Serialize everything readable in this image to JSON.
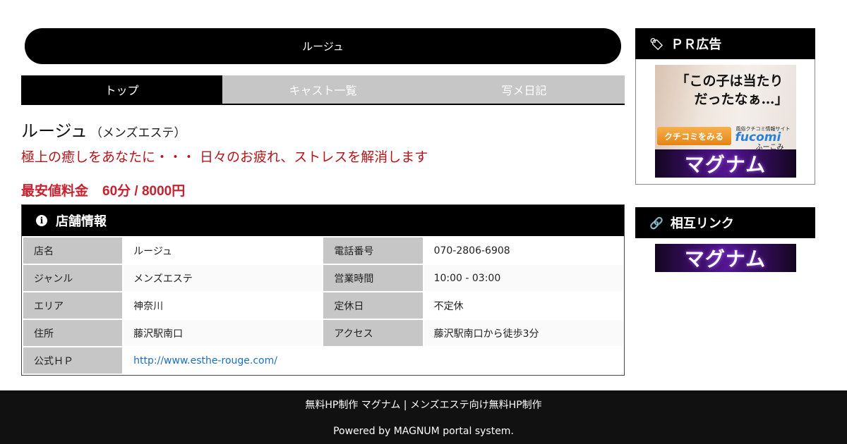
{
  "banner": {
    "title": "ルージュ"
  },
  "tabs": [
    {
      "label": "トップ",
      "active": true
    },
    {
      "label": "キャスト一覧",
      "active": false
    },
    {
      "label": "写メ日記",
      "active": false
    }
  ],
  "shop": {
    "name": "ルージュ",
    "genre": "（メンズエステ）",
    "catch": "極上の癒しをあなたに・・・ 日々のお疲れ、ストレスを解消します",
    "price_label": "最安値料金",
    "price_value": "60分 / 8000円"
  },
  "info": {
    "header": "店舗情報",
    "icon": "info-icon",
    "rows": [
      [
        {
          "label": "店名",
          "value": "ルージュ"
        },
        {
          "label": "電話番号",
          "value": "070-2806-6908"
        }
      ],
      [
        {
          "label": "ジャンル",
          "value": "メンズエステ"
        },
        {
          "label": "営業時間",
          "value": "10:00 - 03:00"
        }
      ],
      [
        {
          "label": "エリア",
          "value": "神奈川"
        },
        {
          "label": "定休日",
          "value": "不定休"
        }
      ],
      [
        {
          "label": "住所",
          "value": "藤沢駅南口"
        },
        {
          "label": "アクセス",
          "value": "藤沢駅南口から徒歩3分"
        }
      ]
    ],
    "hp_label": "公式ＨＰ",
    "hp_url": "http://www.esthe-rouge.com/"
  },
  "sidebar": {
    "pr_title": "ＰＲ広告",
    "pr_icon": "tags-icon",
    "ad_fucomi": {
      "line1": "「この子は当たり",
      "line2": "だったなぁ…」",
      "button": "クチコミをみる",
      "logo_sub": "風俗クチコミ情報サイト",
      "logo": "fucomi",
      "logo_kana": "ふーこみ"
    },
    "ad_magnum": "マグナム",
    "link_title": "相互リンク",
    "link_icon": "link-icon",
    "link_magnum": "マグナム"
  },
  "footer": {
    "line1": "無料HP制作 マグナム | メンズエステ向け無料HP制作",
    "line2": "Powered by MAGNUM portal system."
  },
  "colors": {
    "accent_red": "#c8202e",
    "catch_red": "#b5141a",
    "link_blue": "#1a6fc0"
  }
}
